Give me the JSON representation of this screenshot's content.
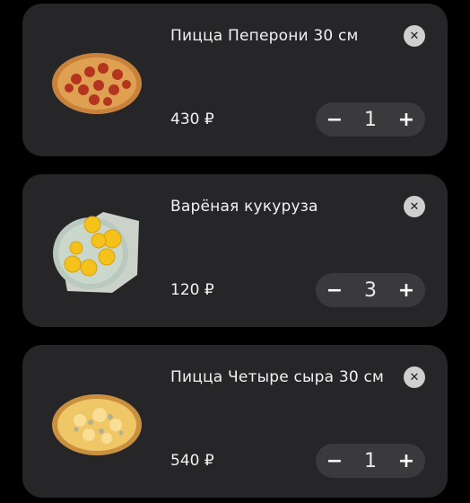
{
  "cart": {
    "items": [
      {
        "title": "Пицца Пеперони 30 см",
        "price": "430 ₽",
        "quantity": "1",
        "image": "pepperoni-pizza"
      },
      {
        "title": "Варёная кукуруза",
        "price": "120 ₽",
        "quantity": "3",
        "image": "boiled-corn"
      },
      {
        "title": "Пицца Четыре сыра 30 см",
        "price": "540 ₽",
        "quantity": "1",
        "image": "four-cheese-pizza"
      }
    ],
    "controls": {
      "remove": "✕",
      "minus": "−",
      "plus": "+"
    }
  },
  "colors": {
    "background": "#000000",
    "card": "#262628",
    "stepper": "#3a3a3c",
    "remove_button": "#cfcfcf"
  }
}
